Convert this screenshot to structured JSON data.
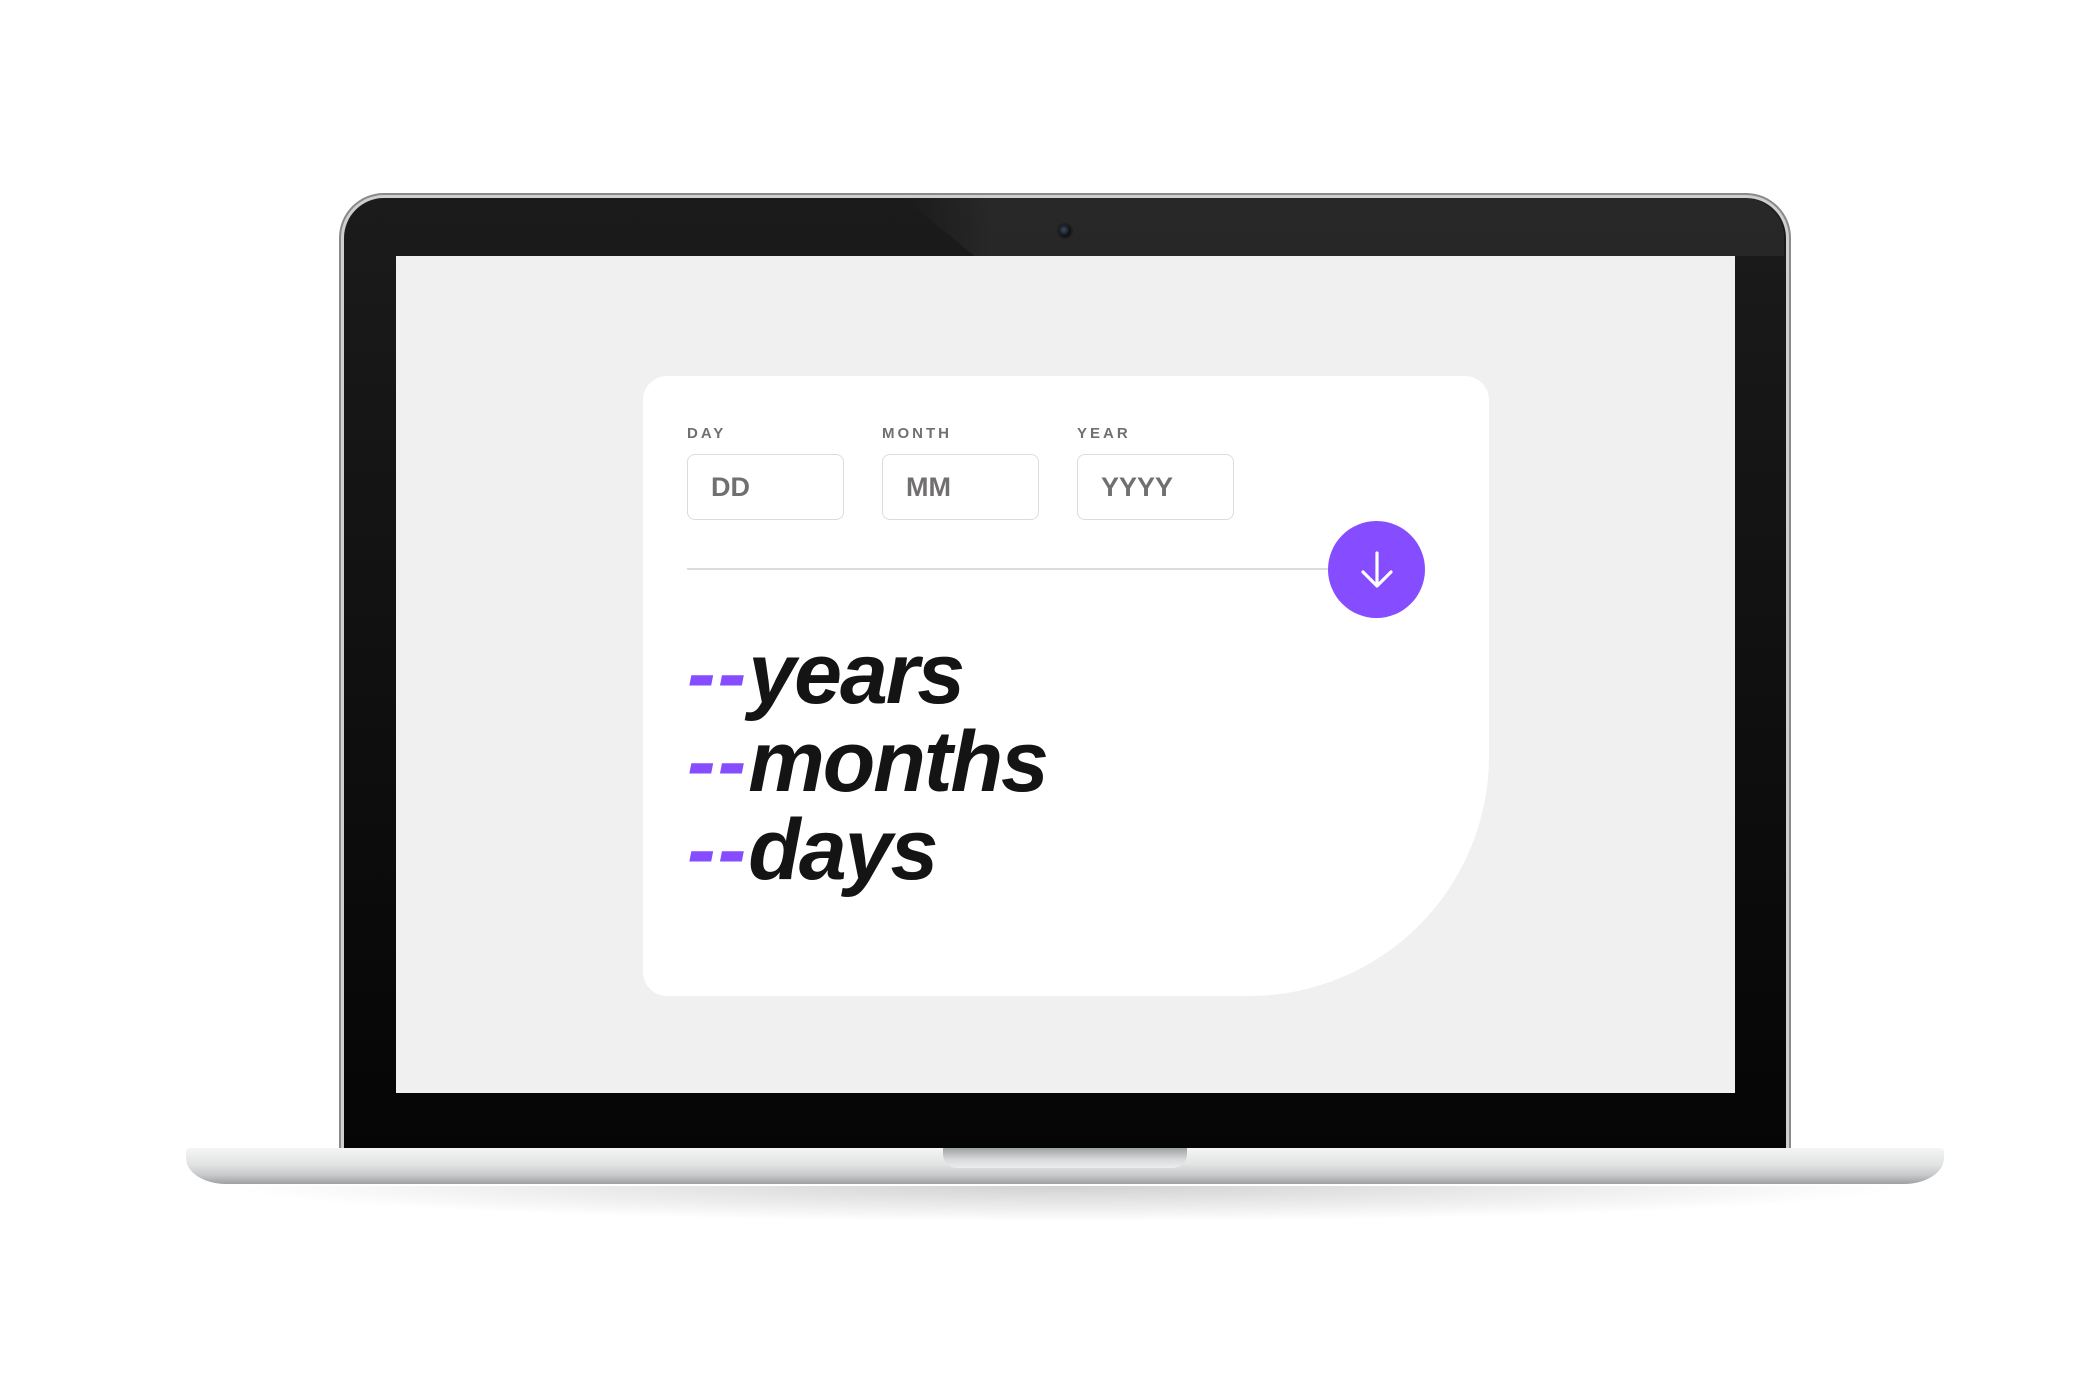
{
  "form": {
    "day": {
      "label": "DAY",
      "placeholder": "DD",
      "value": ""
    },
    "month": {
      "label": "MONTH",
      "placeholder": "MM",
      "value": ""
    },
    "year": {
      "label": "YEAR",
      "placeholder": "YYYY",
      "value": ""
    }
  },
  "submit": {
    "icon": "arrow-down-icon"
  },
  "results": [
    {
      "value": "--",
      "unit": "years"
    },
    {
      "value": "--",
      "unit": "months"
    },
    {
      "value": "--",
      "unit": "days"
    }
  ],
  "colors": {
    "accent": "#854dff",
    "text_dark": "#141414",
    "label_grey": "#716f6f",
    "border": "#dcdcdc",
    "screen_bg": "#f0f0f0",
    "card_bg": "#ffffff"
  }
}
